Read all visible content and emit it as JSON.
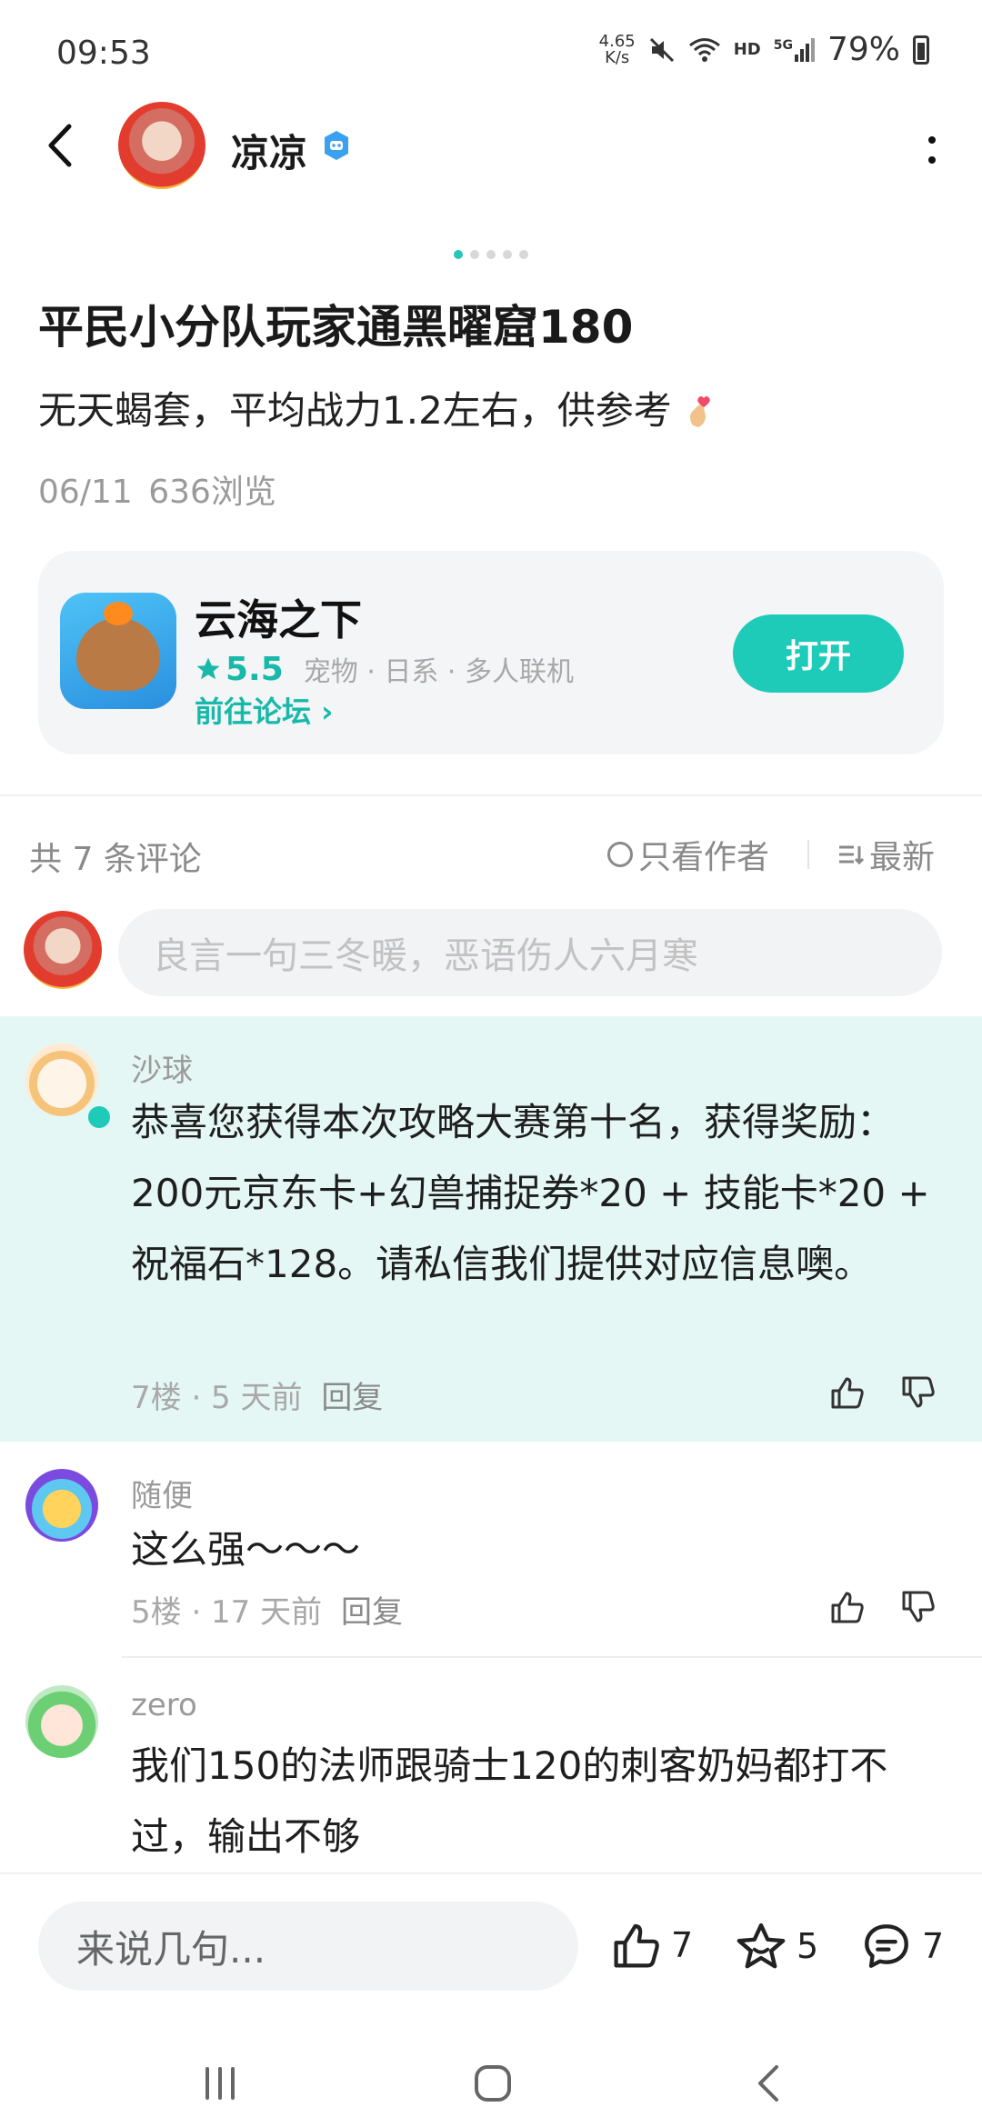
{
  "status_bar": {
    "time": "09:53",
    "speed_value": "4.65",
    "speed_unit": "K/s",
    "hd": "HD",
    "network": "5G",
    "battery": "79%"
  },
  "header": {
    "author": "凉凉"
  },
  "post": {
    "title": "平民小分队玩家通黑曜窟180",
    "subtitle": "无天蝎套，平均战力1.2左右，供参考",
    "date": "06/11",
    "views": "636浏览"
  },
  "app_card": {
    "name": "云海之下",
    "rating": "5.5",
    "tags": "宠物 · 日系 · 多人联机",
    "forum_link": "前往论坛",
    "open_button": "打开"
  },
  "comments_bar": {
    "count": "共 7 条评论",
    "author_only": "只看作者",
    "sort": "最新"
  },
  "comment_input_placeholder": "良言一句三冬暖，恶语伤人六月寒",
  "comments": [
    {
      "name": "沙球",
      "text": "恭喜您获得本次攻略大赛第十名，获得奖励：200元京东卡+幻兽捕捉券*20 + 技能卡*20 + 祝福石*128。请私信我们提供对应信息噢。",
      "meta": "7楼 · 5 天前",
      "reply": "回复"
    },
    {
      "name": "随便",
      "text": "这么强～～～",
      "meta": "5楼 · 17 天前",
      "reply": "回复"
    },
    {
      "name": "zero",
      "text": "我们150的法师跟骑士120的刺客奶妈都打不过，输出不够"
    }
  ],
  "bottom_bar": {
    "placeholder": "来说几句...",
    "likes": "7",
    "favorites": "5",
    "comments": "7"
  },
  "colors": {
    "accent": "#1ecab8",
    "highlight_bg": "#e4f7f4"
  }
}
